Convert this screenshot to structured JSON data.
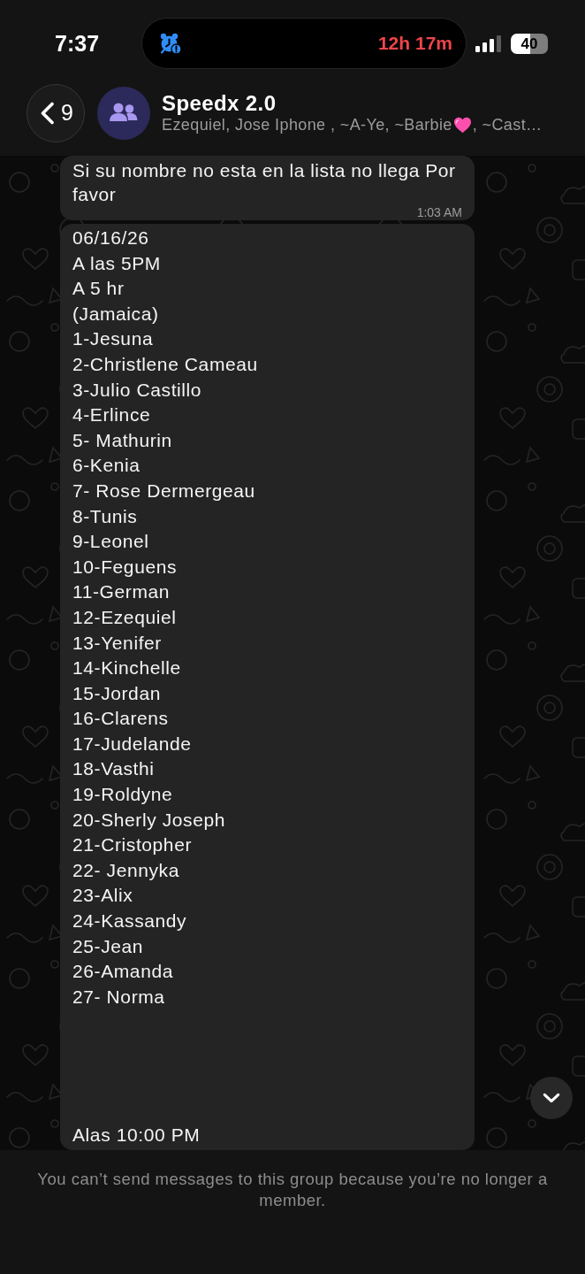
{
  "status_bar": {
    "time": "7:37",
    "timer": "12h 17m",
    "battery": "40"
  },
  "header": {
    "back_count": "9",
    "title": "Speedx 2.0",
    "subtitle": [
      {
        "kind": "text",
        "text": "Ezequiel, Jose Iphone , ~A-Ye, ~Barbie"
      },
      {
        "kind": "emoji"
      },
      {
        "kind": "text",
        "text": ", ~Cast…"
      }
    ]
  },
  "messages": [
    {
      "kind": "text",
      "text": "Si su nombre no esta en la lista no llega Por favor",
      "time": "1:03 AM"
    },
    {
      "kind": "list",
      "lines": [
        "06/16/26",
        "A las 5PM",
        "A 5 hr",
        "(Jamaica)",
        "1-Jesuna",
        "2-Christlene Cameau",
        "3-Julio Castillo",
        "4-Erlince",
        "5- Mathurin",
        "6-Kenia",
        "7- Rose Dermergeau",
        "8-Tunis",
        "9-Leonel",
        "10-Feguens",
        "11-German",
        "12-Ezequiel",
        "13-Yenifer",
        "14-Kinchelle",
        "15-Jordan",
        "16-Clarens",
        "17-Judelande",
        "18-Vasthi",
        "19-Roldyne",
        "20-Sherly Joseph",
        "21-Cristopher",
        "22- Jennyka",
        "23-Alix",
        "24-Kassandy",
        "25-Jean",
        "26-Amanda",
        "27- Norma"
      ],
      "lines_after_gap": [
        "Alas 10:00 PM"
      ]
    }
  ],
  "footer": {
    "notice": "You can’t send messages to this group because you’re no longer a member."
  }
}
